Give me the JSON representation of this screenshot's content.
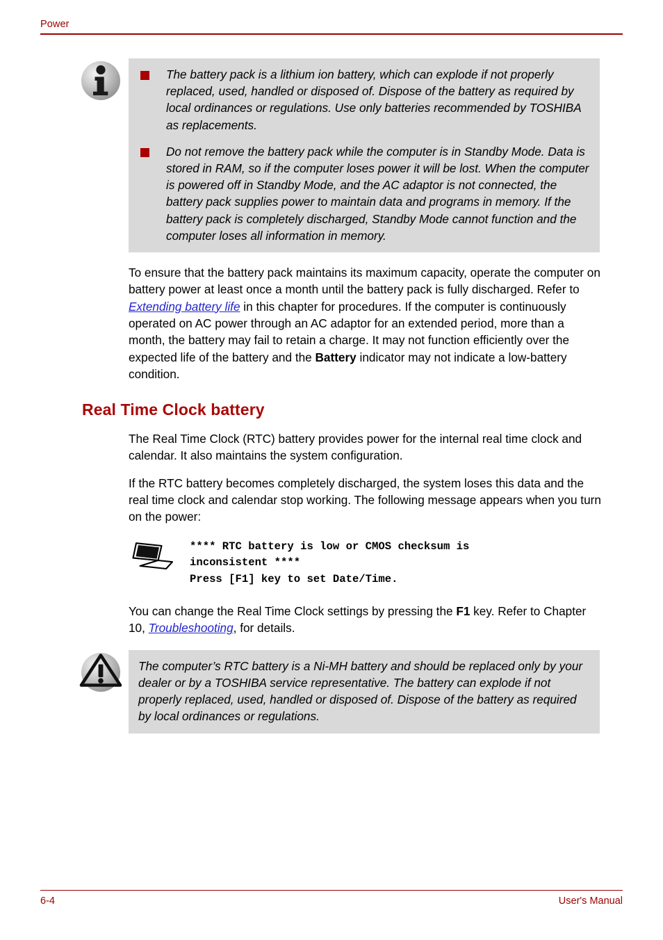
{
  "header": {
    "title": "Power"
  },
  "footer": {
    "page_number": "6-4",
    "manual_label": "User's Manual"
  },
  "note_callout": {
    "icon": "info-icon",
    "bullets": [
      "The battery pack is a lithium ion battery, which can explode if not properly replaced, used, handled or disposed of. Dispose of the battery as required by local ordinances or regulations. Use only batteries recommended by TOSHIBA as replacements.",
      "Do not remove the battery pack while the computer is in Standby Mode. Data is stored in RAM, so if the computer loses power it will be lost. When the computer is powered off in Standby Mode, and the AC adaptor is not connected, the battery pack supplies power to maintain data and programs in memory. If the battery pack is completely discharged, Standby Mode cannot function and the computer loses all information in memory."
    ]
  },
  "body": {
    "paragraph_capacity_part1": "To ensure that the battery pack maintains its maximum capacity, operate the computer on battery power at least once a month until the battery pack is fully discharged. Refer to ",
    "paragraph_capacity_link": "Extending battery life",
    "paragraph_capacity_part2": " in this chapter for procedures. If the computer is continuously operated on AC power through an AC adaptor for an extended period, more than a month, the battery may fail to retain a charge. It may not function efficiently over the expected life of the battery and the ",
    "paragraph_capacity_bold": "Battery",
    "paragraph_capacity_part3": " indicator may not indicate a low-battery condition."
  },
  "section": {
    "heading": "Real Time Clock battery",
    "paragraph_1": "The Real Time Clock (RTC) battery provides power for the internal real time clock and calendar. It also maintains the system configuration.",
    "paragraph_2": "If the RTC battery becomes completely discharged, the system loses this data and the real time clock and calendar stop working. The following message appears when you turn on the power:"
  },
  "message_block": {
    "icon": "laptop-icon",
    "line_1": "**** RTC battery is low or CMOS checksum is",
    "line_2": "inconsistent ****",
    "line_3": "Press [F1] key to set Date/Time."
  },
  "closing": {
    "part1": "You can change the Real Time Clock settings by pressing the ",
    "bold_key": "F1",
    "part2": " key. Refer to Chapter 10, ",
    "link": "Troubleshooting",
    "part3": ", for details."
  },
  "caution_callout": {
    "icon": "warning-triangle-icon",
    "text": "The computer’s RTC battery is a Ni-MH battery and should be replaced only by your dealer or by a TOSHIBA service representative. The battery can explode if not properly replaced, used, handled or disposed of. Dispose of the battery as required by local ordinances or regulations."
  },
  "colors": {
    "accent_red": "#9b0000",
    "heading_red": "#aa0707",
    "bullet_red": "#aa0000",
    "link_blue": "#2525cc",
    "callout_gray": "#d9d9d9"
  }
}
